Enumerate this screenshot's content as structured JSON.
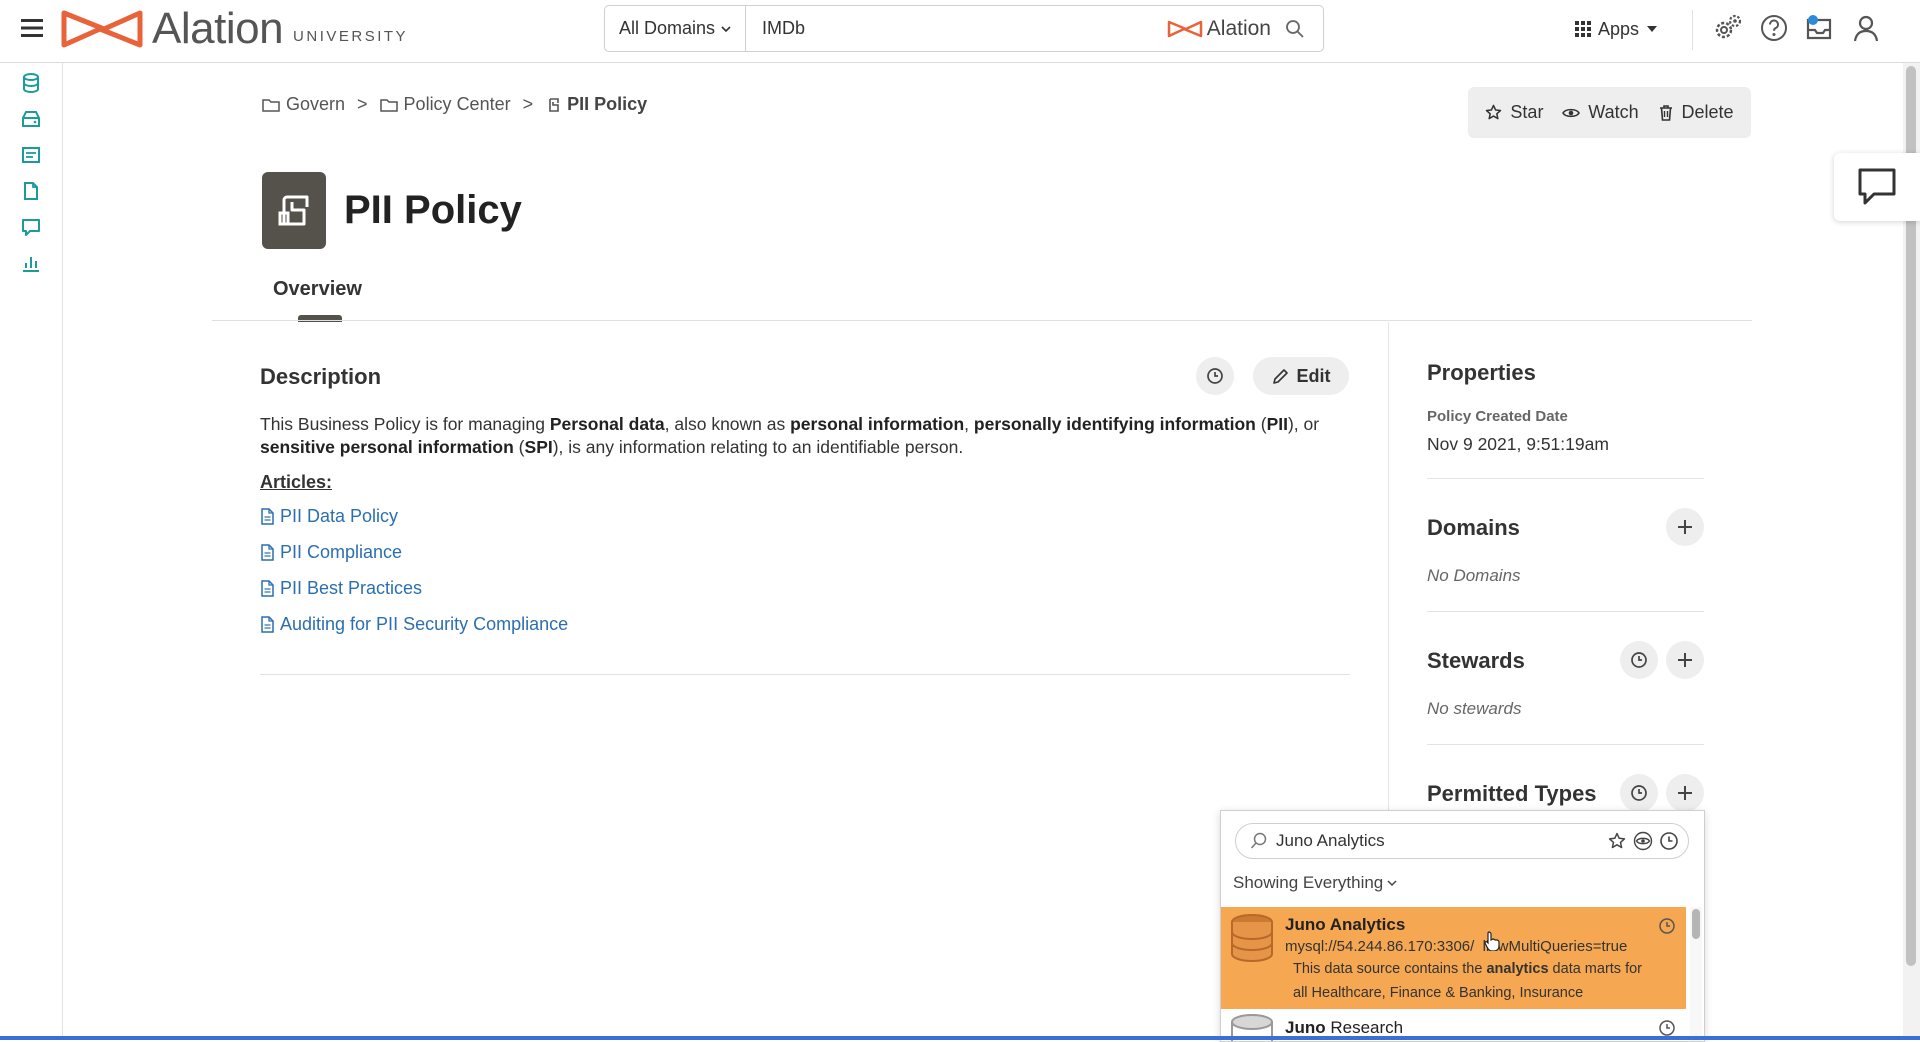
{
  "header": {
    "brand": "Alation",
    "brand_sub": "UNIVERSITY",
    "domain_select": "All Domains",
    "search_value": "IMDb",
    "search_brand": "Alation",
    "apps_label": "Apps"
  },
  "sidebar": {
    "items": [
      "database-icon",
      "storage-icon",
      "catalog-icon",
      "document-icon",
      "conversation-icon",
      "analytics-icon"
    ]
  },
  "breadcrumb": {
    "items": [
      "Govern",
      "Policy Center"
    ],
    "separator": ">",
    "current": "PII Policy"
  },
  "actions": {
    "star": "Star",
    "watch": "Watch",
    "delete": "Delete"
  },
  "page": {
    "title": "PII Policy",
    "tab": "Overview"
  },
  "description": {
    "heading": "Description",
    "edit_label": "Edit",
    "text": {
      "t1": "This Business Policy is for managing ",
      "b1": "Personal data",
      "t2": ", also known as ",
      "b2": "personal information",
      "t3": ", ",
      "b3": "personally identifying information",
      "t4": " (",
      "b4": "PII",
      "t5": "), or ",
      "b5": "sensitive personal information",
      "t6": " (",
      "b6": "SPI",
      "t7": "), is any information relating to an identifiable person."
    },
    "articles_label": "Articles:",
    "articles": [
      "PII Data Policy",
      "PII Compliance",
      "PII Best Practices",
      "Auditing for PII Security Compliance"
    ]
  },
  "properties": {
    "heading": "Properties",
    "created_label": "Policy Created Date",
    "created_value": "Nov 9 2021, 9:51:19am",
    "domains_heading": "Domains",
    "domains_empty": "No Domains",
    "stewards_heading": "Stewards",
    "stewards_empty": "No stewards",
    "permitted_heading": "Permitted Types"
  },
  "popup": {
    "search_value": "Juno Analytics",
    "filter_label": "Showing Everything",
    "results": [
      {
        "title": "Juno Analytics",
        "url_a": "mysql://54.244.86.170:3306/",
        "url_b": "llowMultiQueries=true",
        "desc_a": "This data source contains the ",
        "desc_b": "analytics",
        "desc_c": " data marts for",
        "desc_d": "all Healthcare, Finance & Banking, Insurance"
      },
      {
        "title_a": "Juno",
        "title_b": " Research"
      }
    ]
  },
  "colors": {
    "brand_orange": "#e8623a",
    "link_blue": "#2b6fb0",
    "rail_teal": "#1a9c9c",
    "highlight": "#f5a752",
    "title_icon_bg": "#55524b"
  }
}
